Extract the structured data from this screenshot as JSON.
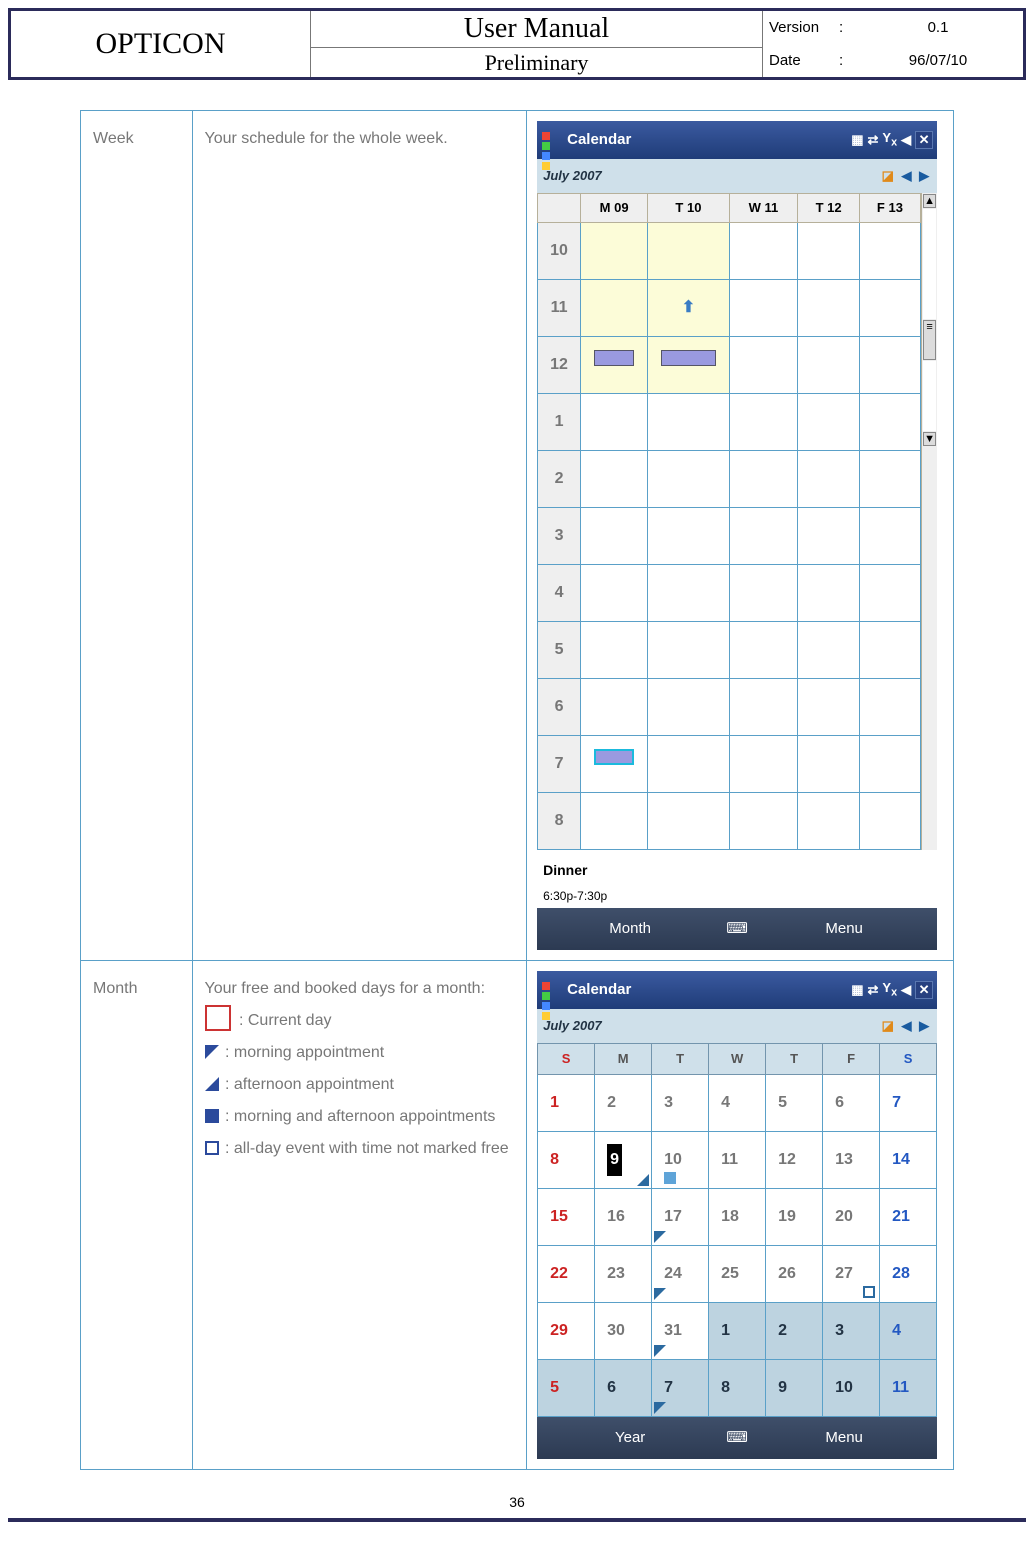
{
  "header": {
    "brand": "OPTICON",
    "title": "User Manual",
    "subtitle": "Preliminary",
    "version_label": "Version",
    "version": "0.1",
    "date_label": "Date",
    "date": "96/07/10",
    "sep": ":"
  },
  "page_number": "36",
  "rows": {
    "week": {
      "name": "Week",
      "desc": "Your schedule for the whole week.",
      "screen": {
        "title": "Calendar",
        "month": "July 2007",
        "days": [
          "M 09",
          "T 10",
          "W 11",
          "T 12",
          "F 13"
        ],
        "hours": [
          "10",
          "11",
          "12",
          "1",
          "2",
          "3",
          "4",
          "5",
          "6",
          "7",
          "8"
        ],
        "appointment_title": "Dinner",
        "appointment_time": "6:30p-7:30p",
        "left_softkey": "Month",
        "right_softkey": "Menu"
      }
    },
    "month": {
      "name": "Month",
      "desc_intro": "Your free and booked days for a month:",
      "legend": {
        "current": ": Current day",
        "morning": ": morning appointment",
        "afternoon": ": afternoon appointment",
        "both": ": morning and afternoon appointments",
        "allday": ": all-day event with time not marked free"
      },
      "screen": {
        "title": "Calendar",
        "month": "July 2007",
        "dow": [
          "S",
          "M",
          "T",
          "W",
          "T",
          "F",
          "S"
        ],
        "weeks": [
          [
            "1",
            "2",
            "3",
            "4",
            "5",
            "6",
            "7"
          ],
          [
            "8",
            "9",
            "10",
            "11",
            "12",
            "13",
            "14"
          ],
          [
            "15",
            "16",
            "17",
            "18",
            "19",
            "20",
            "21"
          ],
          [
            "22",
            "23",
            "24",
            "25",
            "26",
            "27",
            "28"
          ],
          [
            "29",
            "30",
            "31",
            "1",
            "2",
            "3",
            "4"
          ],
          [
            "5",
            "6",
            "7",
            "8",
            "9",
            "10",
            "11"
          ]
        ],
        "left_softkey": "Year",
        "right_softkey": "Menu"
      }
    }
  }
}
